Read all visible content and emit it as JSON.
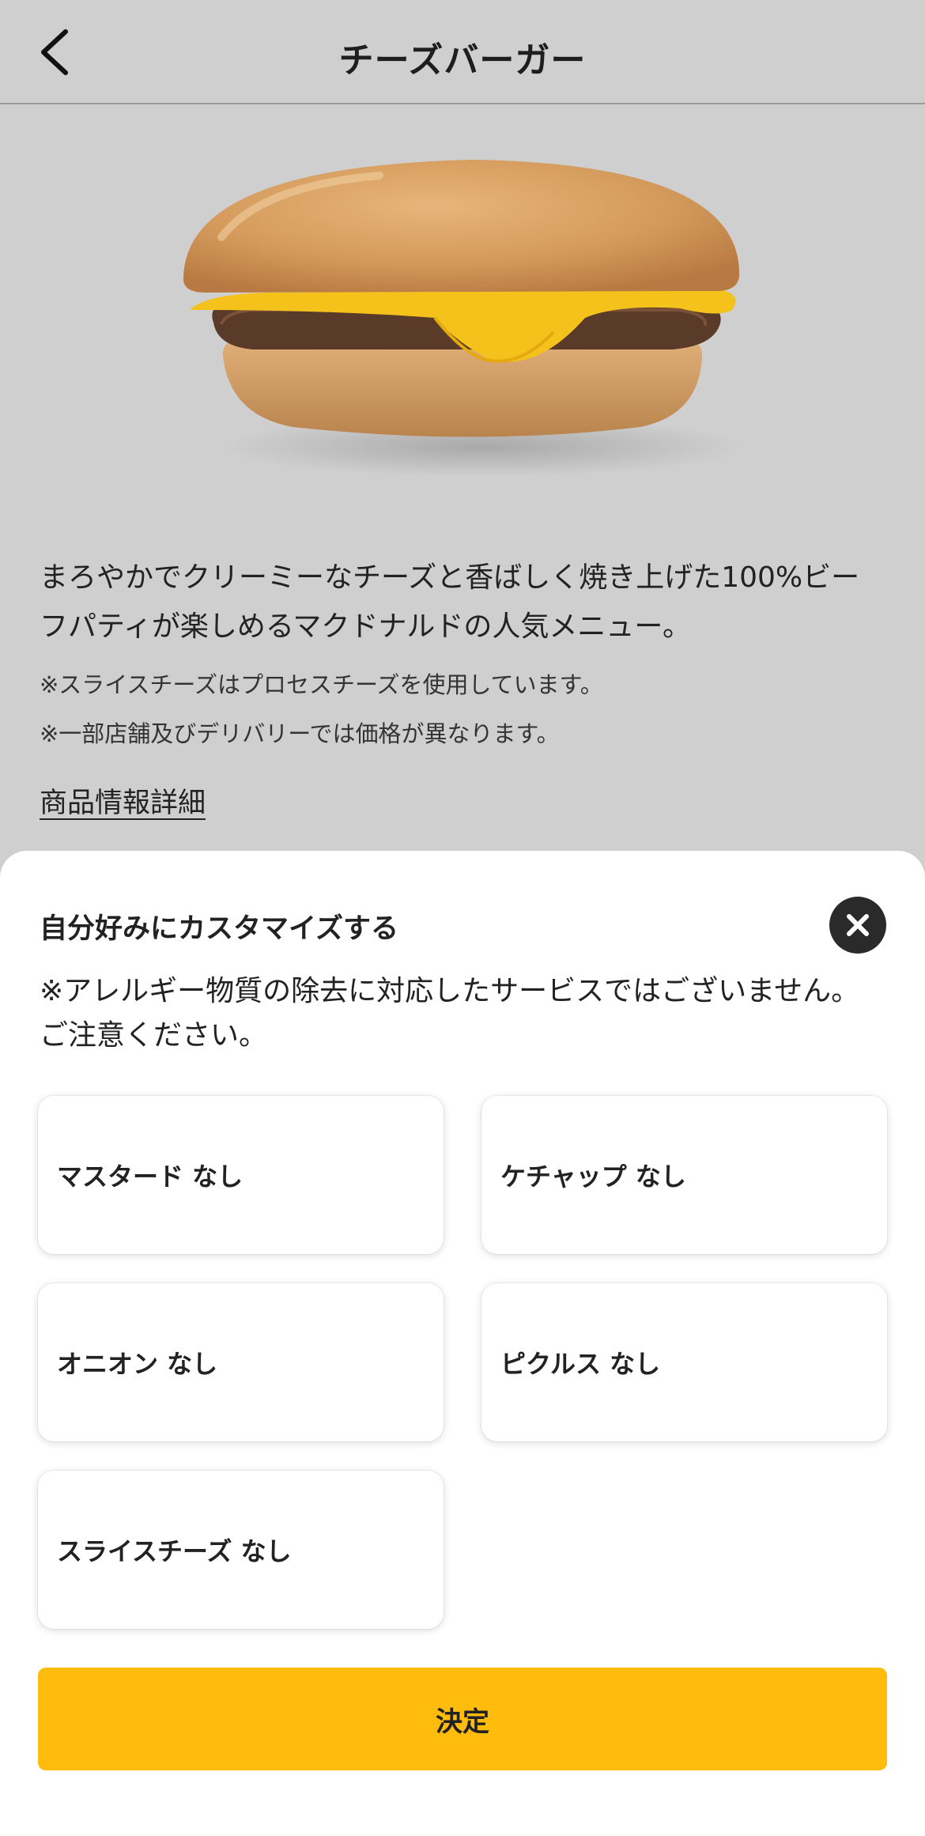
{
  "header": {
    "title": "チーズバーガー",
    "back_icon": "chevron-left-icon"
  },
  "product": {
    "image_icon": "cheeseburger-image",
    "description": "まろやかでクリーミーなチーズと香ばしく焼き上げた100%ビーフパティが楽しめるマクドナルドの人気メニュー。",
    "notes": [
      "※スライスチーズはプロセスチーズを使用しています。",
      "※一部店舗及びデリバリーでは価格が異なります。"
    ],
    "detail_link": "商品情報詳細"
  },
  "customize": {
    "title": "自分好みにカスタマイズする",
    "close_icon": "close-icon",
    "allergy_notice": "※アレルギー物質の除去に対応したサービスではございません。ご注意ください。",
    "options": [
      {
        "label": "マスタード なし"
      },
      {
        "label": "ケチャップ なし"
      },
      {
        "label": "オニオン なし"
      },
      {
        "label": "ピクルス なし"
      },
      {
        "label": "スライスチーズ なし"
      }
    ],
    "confirm_label": "決定"
  },
  "colors": {
    "background_overlay": "#cfcfcf",
    "accent": "#ffbc0d",
    "sheet": "#ffffff"
  }
}
